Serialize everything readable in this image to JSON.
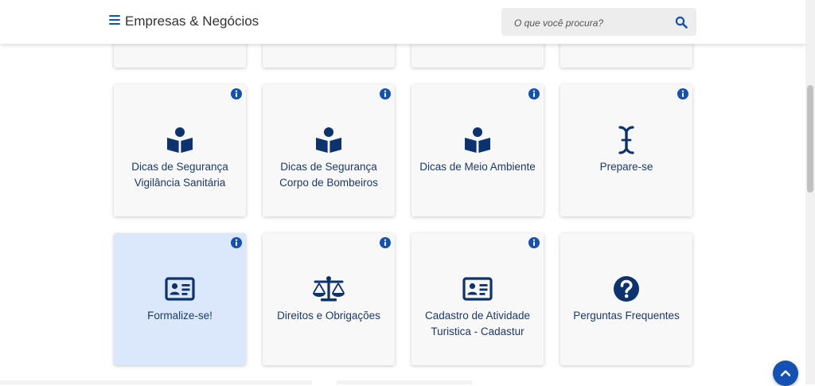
{
  "header": {
    "site_title": "Empresas & Negócios",
    "search_placeholder": "O que você procura?"
  },
  "colors": {
    "brand_blue": "#1351b4",
    "icon_navy": "#0c326f",
    "card_bg": "#f8f8f8",
    "card_active_bg": "#dbe8fb",
    "label_text": "#1a3a6a"
  },
  "cards": [
    {
      "label_line1": "Dicas de Segurança",
      "label_line2": "Vigilância Sanitária",
      "icon": "book-reader-icon",
      "has_info": true
    },
    {
      "label_line1": "Dicas de Segurança",
      "label_line2": "Corpo de Bombeiros",
      "icon": "book-reader-icon",
      "has_info": true
    },
    {
      "label_line1": "Dicas de Meio Ambiente",
      "label_line2": "",
      "icon": "book-reader-icon",
      "has_info": true
    },
    {
      "label_line1": "Prepare-se",
      "label_line2": "",
      "icon": "i-beam-cursor-icon",
      "has_info": true
    },
    {
      "label_line1": "Formalize-se!",
      "label_line2": "",
      "icon": "id-card-icon",
      "has_info": true,
      "active": true
    },
    {
      "label_line1": "Direitos e Obrigações",
      "label_line2": "",
      "icon": "balance-scale-icon",
      "has_info": true
    },
    {
      "label_line1": "Cadastro de Atividade",
      "label_line2": "Turistica - Cadastur",
      "icon": "id-card-icon",
      "has_info": true
    },
    {
      "label_line1": "Perguntas Frequentes",
      "label_line2": "",
      "icon": "question-circle-icon",
      "has_info": false
    }
  ]
}
